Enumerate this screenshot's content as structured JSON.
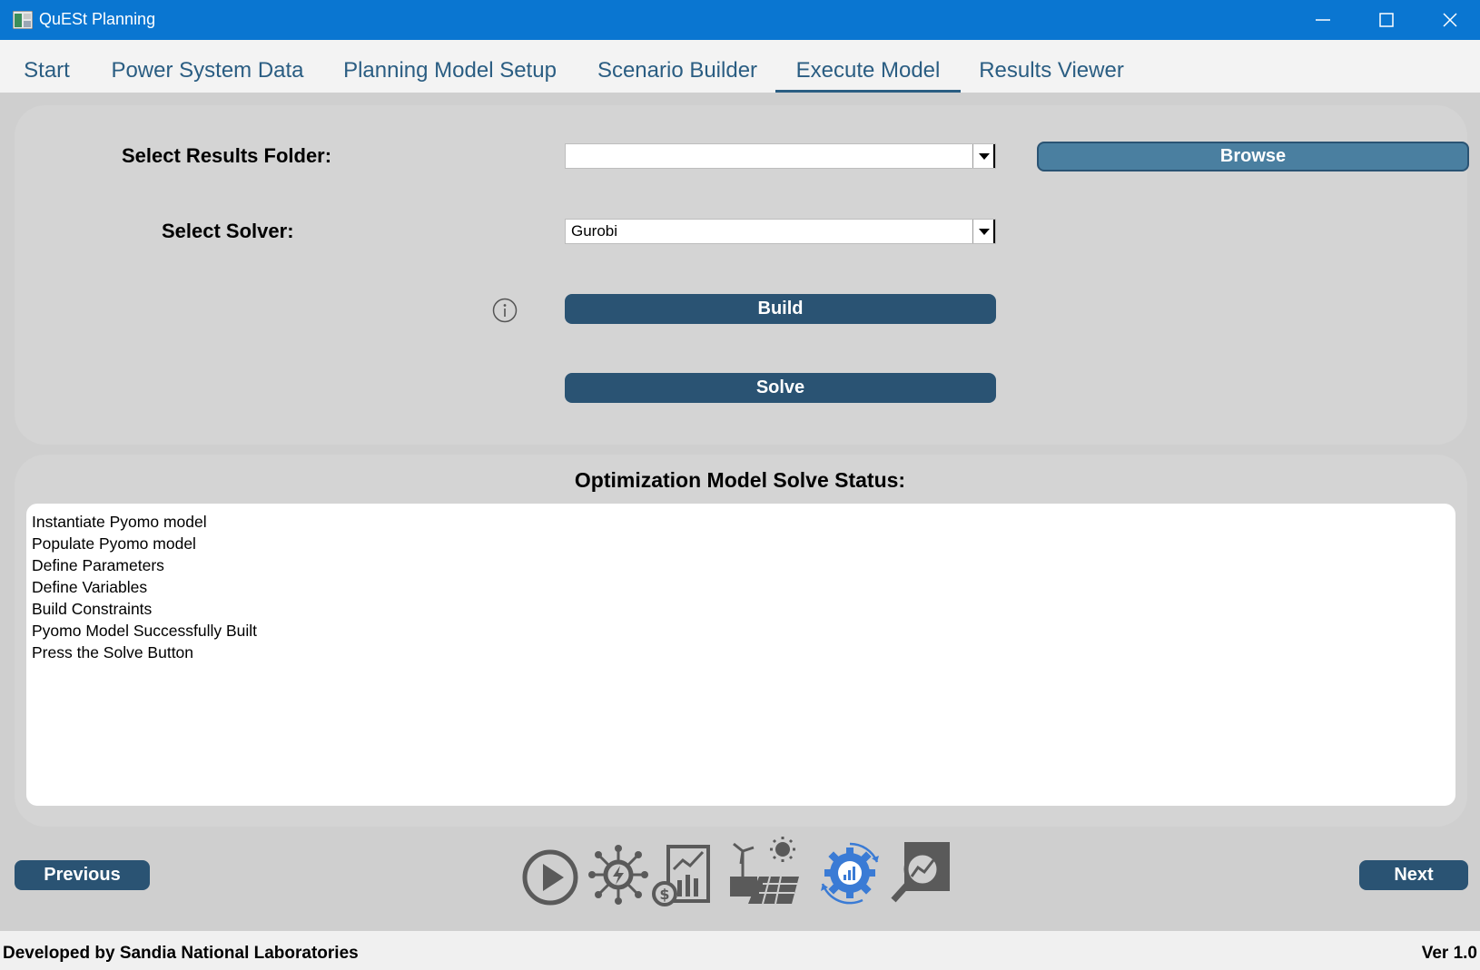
{
  "window": {
    "title": "QuESt Planning",
    "icons": [
      "app-icon",
      "minimize-icon",
      "maximize-icon",
      "close-icon"
    ]
  },
  "tabs": [
    {
      "label": "Start",
      "active": false
    },
    {
      "label": "Power System Data",
      "active": false
    },
    {
      "label": "Planning Model Setup",
      "active": false
    },
    {
      "label": "Scenario Builder",
      "active": false
    },
    {
      "label": "Execute Model",
      "active": true
    },
    {
      "label": "Results Viewer",
      "active": false
    }
  ],
  "setup": {
    "results_folder_label": "Select Results Folder:",
    "results_folder_value": "",
    "browse_label": "Browse",
    "solver_label": "Select Solver:",
    "solver_value": "Gurobi",
    "build_label": "Build",
    "solve_label": "Solve"
  },
  "status": {
    "title": "Optimization Model Solve Status:",
    "lines": [
      "Instantiate Pyomo model",
      "Populate Pyomo model",
      "Define Parameters",
      "Define Variables",
      "Build Constraints",
      "Pyomo Model Successfully Built",
      "Press the Solve Button"
    ]
  },
  "navigation": {
    "previous_label": "Previous",
    "next_label": "Next",
    "stage_icons": [
      "play-icon",
      "power-network-icon",
      "finance-chart-icon",
      "renewables-icon",
      "gear-chart-icon",
      "analysis-icon"
    ],
    "active_stage_color": "#3a7bd5"
  },
  "footer": {
    "developer": "Developed by Sandia National Laboratories",
    "version": "Ver 1.0"
  },
  "colors": {
    "titlebar": "#0a76d1",
    "tab_text": "#2a5d82",
    "button": "#2a5373",
    "browse_button": "#4a7fa0"
  }
}
